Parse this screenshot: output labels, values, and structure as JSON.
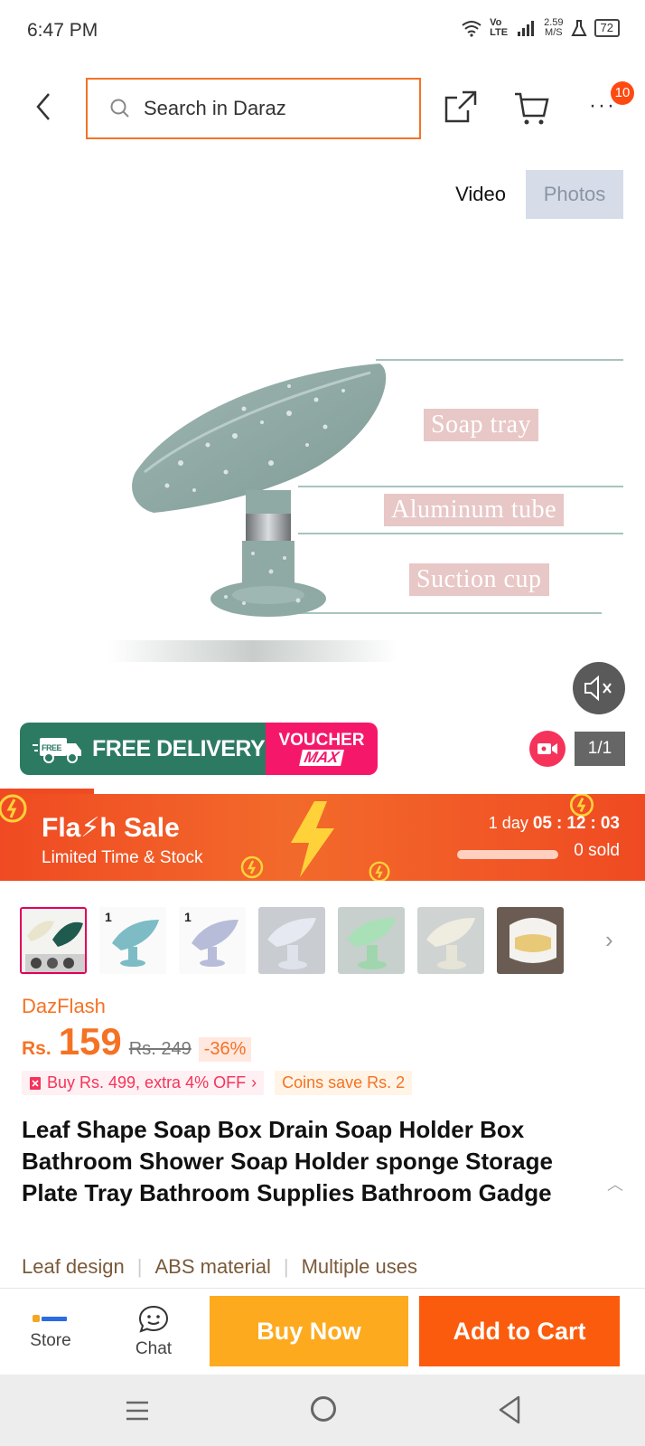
{
  "status_bar": {
    "time": "6:47 PM",
    "network_label": "Vo LTE",
    "speed": "2.59",
    "speed_unit": "M/S",
    "battery": "72"
  },
  "header": {
    "search_placeholder": "Search in Daraz",
    "cart_badge": "10",
    "icons": [
      "back-arrow-icon",
      "search-icon",
      "share-icon",
      "cart-icon",
      "more-icon"
    ]
  },
  "media": {
    "tabs": [
      "Video",
      "Photos"
    ],
    "active_tab": "Photos",
    "callouts": [
      "Soap tray",
      "Aluminum tube",
      "Suction cup"
    ],
    "free_delivery": "FREE DELIVERY",
    "free_tag": "FREE",
    "voucher": "VOUCHER",
    "voucher_max": "MAX",
    "page_indicator": "1/1"
  },
  "flash_sale": {
    "title": "Fla⚡h Sale",
    "subtitle": "Limited Time & Stock",
    "days": "1 day",
    "hours": "05",
    "minutes": "12",
    "seconds": "03",
    "sold": "0 sold",
    "sold_progress": 0
  },
  "product": {
    "campaign": "DazFlash",
    "currency": "Rs.",
    "price": "159",
    "original_price": "Rs. 249",
    "discount": "-36%",
    "promo": "Buy Rs. 499, extra 4% OFF",
    "coins": "Coins save Rs. 2",
    "title": "Leaf Shape Soap Box Drain Soap Holder Box Bathroom Shower Soap Holder sponge Storage Plate Tray Bathroom Supplies Bathroom Gadge",
    "features": [
      "Leaf design",
      "ABS material",
      "Multiple uses"
    ],
    "thumbnail_count": 8
  },
  "bottom_bar": {
    "store_label": "Store",
    "chat_label": "Chat",
    "buy_now": "Buy Now",
    "add_to_cart": "Add to Cart"
  },
  "colors": {
    "brand_orange": "#f57224",
    "buy_now": "#fdaa1f",
    "add_to_cart": "#fb5b0c",
    "flash_red": "#f04a22"
  }
}
